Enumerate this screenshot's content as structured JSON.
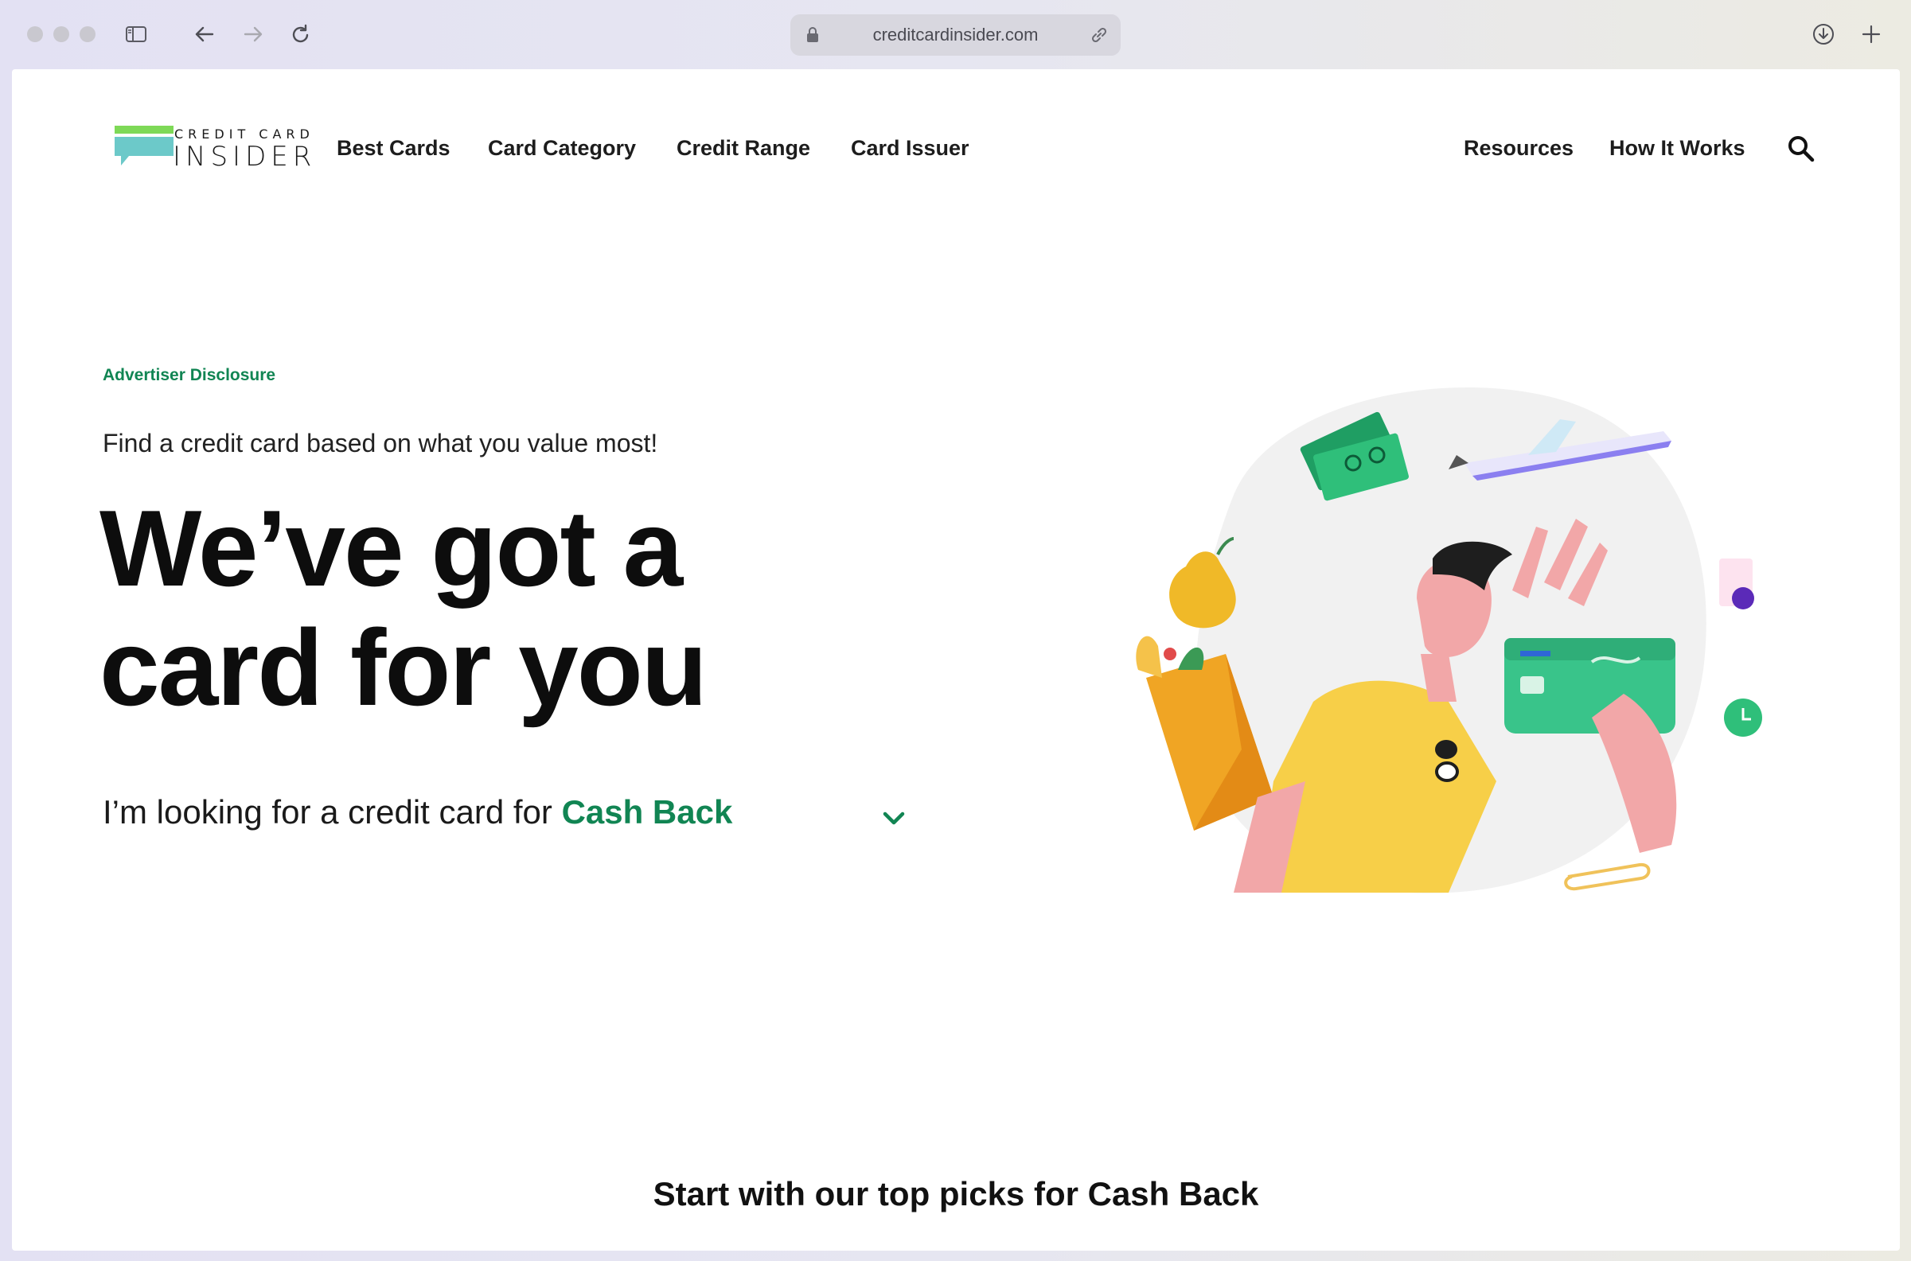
{
  "browser": {
    "url": "creditcardinsider.com",
    "icons": [
      "sidebar-icon",
      "back-arrow-icon",
      "forward-arrow-icon",
      "reload-icon",
      "lock-icon",
      "link-icon",
      "download-icon",
      "plus-icon"
    ]
  },
  "site": {
    "logo_small": "CREDIT CARD",
    "logo_big": "INSIDER",
    "brand_green": "#7ed957",
    "brand_teal": "#6cc9c9",
    "nav_left": [
      "Best Cards",
      "Card Category",
      "Credit Range",
      "Card Issuer"
    ],
    "nav_right": [
      "Resources",
      "How It Works"
    ]
  },
  "hero": {
    "disclosure": "Advertiser Disclosure",
    "subhead": "Find a credit card based on what you value most!",
    "title_line1": "We’ve got a",
    "title_line2": "card for you",
    "looking_prefix": "I’m looking for a credit card for ",
    "looking_choice": "Cash Back",
    "accent": "#118553"
  },
  "section": {
    "top_picks": "Start with our top picks for Cash Back"
  }
}
